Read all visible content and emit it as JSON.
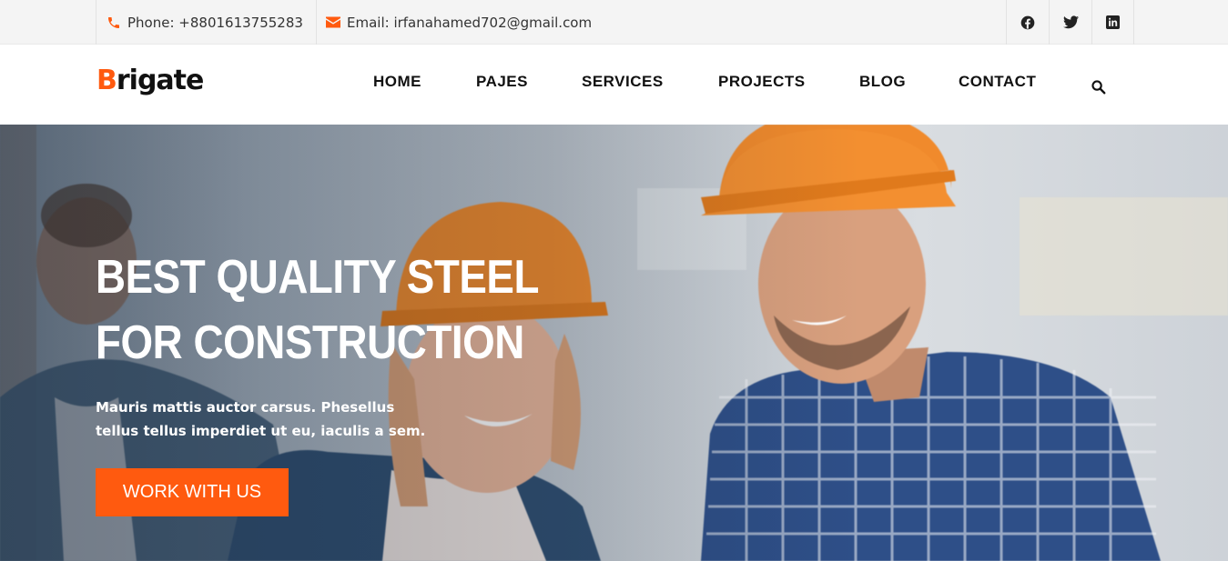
{
  "topbar": {
    "phone_label": "Phone: +8801613755283",
    "email_label": "Email: irfanahamed702@gmail.com",
    "social_icons": [
      "facebook-icon",
      "twitter-icon",
      "linkedin-icon"
    ]
  },
  "header": {
    "logo_first": "B",
    "logo_rest": "rigate",
    "nav": [
      "HOME",
      "PAJES",
      "SERVICES",
      "PROJECTS",
      "BLOG",
      "CONTACT"
    ]
  },
  "hero": {
    "title": "BEST QUALITY STEEL FOR CONSTRUCTION",
    "text": "Mauris mattis auctor carsus. Phesellus tellus tellus imperdiet ut eu, iaculis a sem.",
    "cta_label": "WORK WITH US"
  },
  "colors": {
    "accent": "#ff5a0f",
    "topbar_bg": "#f4f4f4",
    "text_dark": "#111111"
  }
}
